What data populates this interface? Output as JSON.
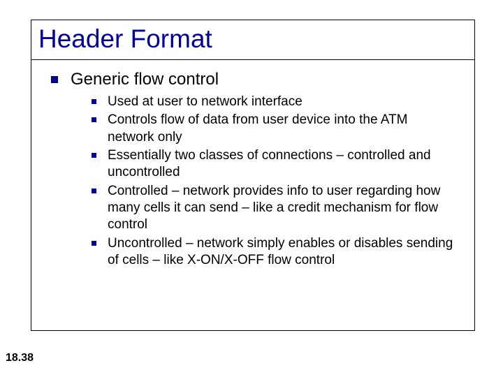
{
  "slide": {
    "title": "Header Format",
    "number": "18.38",
    "level1": "Generic flow control",
    "level2": [
      "Used at user to network interface",
      "Controls flow of data from user device into the ATM network only",
      "Essentially two classes of connections – controlled and uncontrolled",
      "Controlled – network provides info to user regarding how many cells it can send – like a credit mechanism for flow control",
      "Uncontrolled – network simply enables or disables sending of cells – like X-ON/X-OFF flow control"
    ]
  }
}
